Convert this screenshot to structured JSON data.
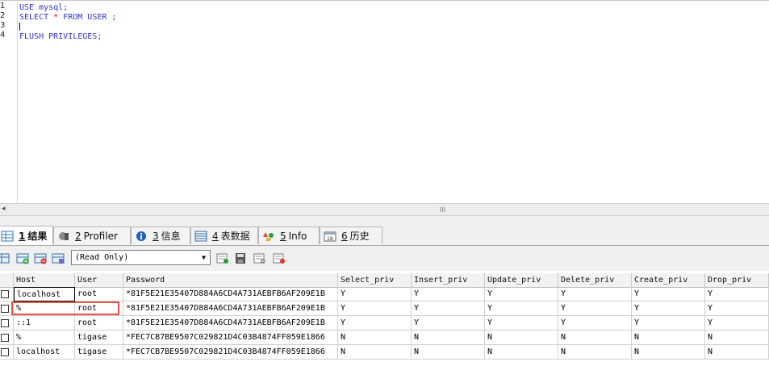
{
  "editor": {
    "line_numbers": [
      "1",
      "2",
      "3",
      "4"
    ],
    "lines": [
      {
        "text": "USE mysql;"
      },
      {
        "pre": "SELECT ",
        "star": "*",
        "post": " FROM USER ;"
      },
      {
        "text": ""
      },
      {
        "text": "FLUSH PRIVILEGES;"
      }
    ]
  },
  "scrollbar": {
    "left_arrow": "◂",
    "grip": "III"
  },
  "tabs": [
    {
      "num": "1",
      "label": "结果",
      "icon": "grid-icon"
    },
    {
      "num": "2",
      "label": "Profiler",
      "icon": "profiler-icon"
    },
    {
      "num": "3",
      "label": "信息",
      "icon": "info-icon"
    },
    {
      "num": "4",
      "label": "表数据",
      "icon": "table-data-icon"
    },
    {
      "num": "5",
      "label": "Info",
      "icon": "info-shapes-icon"
    },
    {
      "num": "6",
      "label": "历史",
      "icon": "history-calendar-icon"
    }
  ],
  "toolbar": {
    "mode_select": "(Read Only)"
  },
  "grid": {
    "columns": [
      "Host",
      "User",
      "Password",
      "Select_priv",
      "Insert_priv",
      "Update_priv",
      "Delete_priv",
      "Create_priv",
      "Drop_priv"
    ],
    "rows": [
      [
        "localhost",
        "root",
        "*81F5E21E35407D884A6CD4A731AEBFB6AF209E1B",
        "Y",
        "Y",
        "Y",
        "Y",
        "Y",
        "Y"
      ],
      [
        "%",
        "root",
        "*81F5E21E35407D884A6CD4A731AEBFB6AF209E1B",
        "Y",
        "Y",
        "Y",
        "Y",
        "Y",
        "Y"
      ],
      [
        "::1",
        "root",
        "*81F5E21E35407D884A6CD4A731AEBFB6AF209E1B",
        "Y",
        "Y",
        "Y",
        "Y",
        "Y",
        "Y"
      ],
      [
        "%",
        "tigase",
        "*FEC7CB7BE9507C029821D4C03B4874FF059E1866",
        "N",
        "N",
        "N",
        "N",
        "N",
        "N"
      ],
      [
        "localhost",
        "tigase",
        "*FEC7CB7BE9507C029821D4C03B4874FF059E1866",
        "N",
        "N",
        "N",
        "N",
        "N",
        "N"
      ]
    ]
  },
  "colors": {
    "highlight": "#e8534a",
    "code": "#3333cc",
    "star": "#cc0000"
  }
}
